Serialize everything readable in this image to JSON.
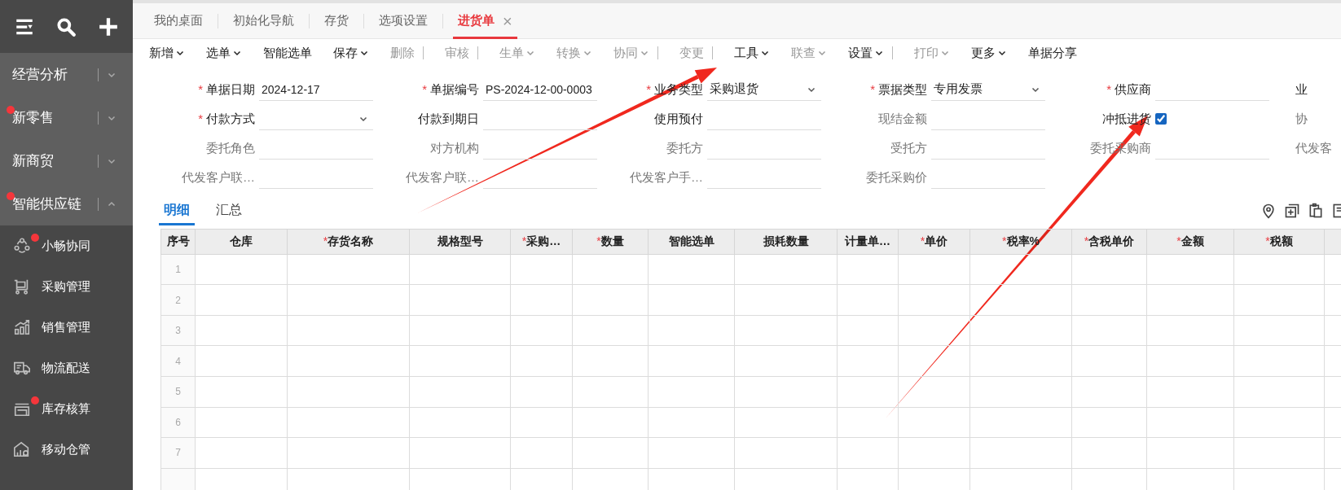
{
  "sidebar": {
    "groups": [
      {
        "label": "经营分析",
        "badge": false,
        "expanded": false
      },
      {
        "label": "新零售",
        "badge": true,
        "expanded": false
      },
      {
        "label": "新商贸",
        "badge": false,
        "expanded": false
      },
      {
        "label": "智能供应链",
        "badge": true,
        "expanded": true
      }
    ],
    "items": [
      {
        "label": "小畅协同",
        "badge": true
      },
      {
        "label": "采购管理",
        "badge": false
      },
      {
        "label": "销售管理",
        "badge": false
      },
      {
        "label": "物流配送",
        "badge": false
      },
      {
        "label": "库存核算",
        "badge": true
      },
      {
        "label": "移动仓管",
        "badge": false
      }
    ]
  },
  "tabs": [
    {
      "label": "我的桌面",
      "selected": false
    },
    {
      "label": "初始化导航",
      "selected": false
    },
    {
      "label": "存货",
      "selected": false
    },
    {
      "label": "选项设置",
      "selected": false
    },
    {
      "label": "进货单",
      "selected": true,
      "close": "×"
    }
  ],
  "toolbar": [
    {
      "label": "新增",
      "dropdown": true,
      "disabled": false,
      "divider": false
    },
    {
      "label": "选单",
      "dropdown": true,
      "disabled": false,
      "divider": false
    },
    {
      "label": "智能选单",
      "dropdown": false,
      "disabled": false,
      "divider": false
    },
    {
      "label": "保存",
      "dropdown": true,
      "disabled": false,
      "divider": false
    },
    {
      "label": "删除",
      "dropdown": false,
      "disabled": true,
      "divider": true
    },
    {
      "label": "审核",
      "dropdown": false,
      "disabled": true,
      "divider": true
    },
    {
      "label": "生单",
      "dropdown": true,
      "disabled": true,
      "divider": false
    },
    {
      "label": "转换",
      "dropdown": true,
      "disabled": true,
      "divider": false
    },
    {
      "label": "协同",
      "dropdown": true,
      "disabled": true,
      "divider": true
    },
    {
      "label": "变更",
      "dropdown": false,
      "disabled": true,
      "divider": true
    },
    {
      "label": "工具",
      "dropdown": true,
      "disabled": false,
      "divider": false
    },
    {
      "label": "联查",
      "dropdown": true,
      "disabled": true,
      "divider": false
    },
    {
      "label": "设置",
      "dropdown": true,
      "disabled": false,
      "divider": true
    },
    {
      "label": "打印",
      "dropdown": true,
      "disabled": true,
      "divider": false
    },
    {
      "label": "更多",
      "dropdown": true,
      "disabled": false,
      "divider": false
    },
    {
      "label": "单据分享",
      "dropdown": false,
      "disabled": false,
      "divider": false
    }
  ],
  "form": {
    "rows": [
      {
        "fields": [
          {
            "kind": "text",
            "required_mark": "*",
            "label": "单据日期",
            "disabled": false,
            "value": "2024-12-17"
          },
          {
            "kind": "text",
            "required_mark": "*",
            "label": "单据编号",
            "disabled": false,
            "value": "PS-2024-12-00-0003"
          },
          {
            "kind": "select",
            "required_mark": "*",
            "label": "业务类型",
            "disabled": false,
            "value": "采购退货"
          },
          {
            "kind": "select",
            "required_mark": "*",
            "label": "票据类型",
            "disabled": false,
            "value": "专用发票"
          },
          {
            "kind": "text",
            "required_mark": "*",
            "label": "供应商",
            "disabled": false
          }
        ],
        "cut_label": "业"
      },
      {
        "fields": [
          {
            "kind": "select",
            "required_mark": "*",
            "label": "付款方式",
            "disabled": false
          },
          {
            "kind": "text",
            "label": "付款到期日",
            "disabled": false
          },
          {
            "kind": "text",
            "label": "使用预付",
            "disabled": false
          },
          {
            "kind": "text",
            "label": "现结金额",
            "disabled": true
          },
          {
            "kind": "checkbox",
            "label": "冲抵进货",
            "disabled": false,
            "checked": true
          }
        ],
        "cut_label": "协"
      },
      {
        "fields": [
          {
            "kind": "text",
            "label": "委托角色",
            "disabled": true
          },
          {
            "kind": "text",
            "label": "对方机构",
            "disabled": true
          },
          {
            "kind": "text",
            "label": "委托方",
            "disabled": true
          },
          {
            "kind": "text",
            "label": "受托方",
            "disabled": true
          },
          {
            "kind": "text",
            "label": "委托采购商",
            "disabled": true
          }
        ],
        "cut_label": "代发客"
      },
      {
        "fields": [
          {
            "kind": "text",
            "label": "代发客户联…",
            "disabled": true
          },
          {
            "kind": "text",
            "label": "代发客户联…",
            "disabled": true
          },
          {
            "kind": "text",
            "label": "代发客户手…",
            "disabled": true
          },
          {
            "kind": "text",
            "label": "委托采购价",
            "disabled": true
          }
        ]
      }
    ]
  },
  "detail_tabs": [
    {
      "label": "明细",
      "selected": true
    },
    {
      "label": "汇总",
      "selected": false
    }
  ],
  "table": {
    "columns": [
      {
        "label": "序号"
      },
      {
        "label": "仓库"
      },
      {
        "required_mark": "*",
        "label": "存货名称"
      },
      {
        "label": "规格型号"
      },
      {
        "required_mark": "*",
        "label": "采购…"
      },
      {
        "required_mark": "*",
        "label": "数量"
      },
      {
        "label": "智能选单"
      },
      {
        "label": "损耗数量"
      },
      {
        "label": "计量单…"
      },
      {
        "required_mark": "*",
        "label": "单价"
      },
      {
        "required_mark": "*",
        "label": "税率%"
      },
      {
        "required_mark": "*",
        "label": "含税单价"
      },
      {
        "required_mark": "*",
        "label": "金额"
      },
      {
        "required_mark": "*",
        "label": "税额"
      }
    ],
    "rows": [
      {
        "index": "1"
      },
      {
        "index": "2"
      },
      {
        "index": "3"
      },
      {
        "index": "4"
      },
      {
        "index": "5"
      },
      {
        "index": "6"
      },
      {
        "index": "7"
      }
    ]
  },
  "annotations": [
    {
      "kind": "arrow"
    },
    {
      "kind": "arrow"
    }
  ]
}
